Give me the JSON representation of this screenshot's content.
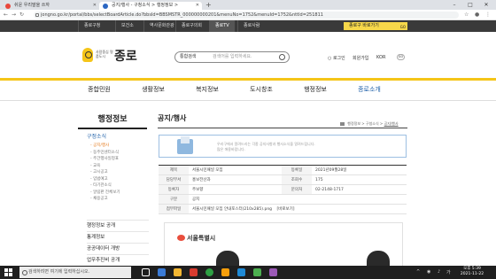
{
  "browser": {
    "tabs": [
      {
        "title": "쉬운 우리말을 쓰자",
        "favicon_color": "#e9473b"
      },
      {
        "title": "공지/행사 - 구청소식 > 행정정보 >",
        "favicon_color": "#2b66c2"
      }
    ],
    "new_tab": "+",
    "window_controls": [
      "–",
      "□",
      "✕"
    ],
    "nav": {
      "back": "←",
      "forward": "→",
      "reload": "↻",
      "home": "⌂"
    },
    "url": "jongno.go.kr/portal/bbs/selectBoardArticle.do?bbsId=BBSMSTR_000000000201&menuNo=1752&menuId=1752&nttId=251811"
  },
  "site_bar": {
    "tabs": [
      "종로구청",
      "보건소",
      "역사문화관광",
      "종로구의회",
      "종로TV",
      "종로사람"
    ],
    "active_tab": "종로TV",
    "quick_label": "종로구 바로가기",
    "quick_go": "GO"
  },
  "header": {
    "logo_sub": "사람중심 명품도시",
    "logo_main": "종로",
    "search_select": "통합검색",
    "search_placeholder": "검색어를 입력하세요.",
    "login": "로그인",
    "join": "회원가입",
    "lang": "KOR",
    "lang_go": "GO"
  },
  "main_nav": [
    "종합민원",
    "생활정보",
    "복지정보",
    "도시창조",
    "행정정보",
    "종로소개"
  ],
  "main_nav_active": "종로소개",
  "lnb": {
    "title": "행정정보",
    "section_head": "구정소식",
    "items": [
      "공지/행사",
      "동주민센터소식",
      "주간행사일정표",
      "교육",
      "고시공고",
      "입법예고",
      "타기관소식",
      "알림판 전체보기",
      "채용공고"
    ],
    "active_item": "공지/행사",
    "sections": [
      "행정정보 공개",
      "통계정보",
      "공공데이터 개방",
      "업무추진비 공개"
    ]
  },
  "content": {
    "title": "공지/행사",
    "breadcrumb": [
      "행정정보",
      "구청소식",
      "공지/행사"
    ],
    "info_text": [
      "우리구에서 알려드리는 각종 공지사항과 행사소식을 알려드립니다.",
      "많은 애용바랍니다."
    ],
    "table": {
      "labels": {
        "subject": "제목",
        "dept": "담당부서",
        "writer": "등록자",
        "type": "구분",
        "attach": "첨부파일",
        "date": "등록일",
        "views": "조회수",
        "phone": "문의처"
      },
      "subject": "서울시민패널 모집",
      "dept": "홍보전산과",
      "writer": "주보향",
      "type": "공지",
      "attach": "서울시민패널 모집 안내포스터(210x285).png",
      "attach_action": "[바로보기]",
      "date": "2021년09월28일",
      "views": "175",
      "phone": "02-2148-1717"
    },
    "image_brand": "서울특별시"
  },
  "taskbar": {
    "search_placeholder": "검색하려면 여기에 입력하십시오.",
    "time": "오후 5:39",
    "date": "2021-11-22",
    "tray_lang": "가",
    "app_colors": [
      "#ffffff",
      "#3b7bd6",
      "#f2b632",
      "#d83b2f",
      "#2ea043",
      "#f59e0b",
      "#1f8ad6",
      "#4caf50",
      "#9b59b6"
    ]
  }
}
